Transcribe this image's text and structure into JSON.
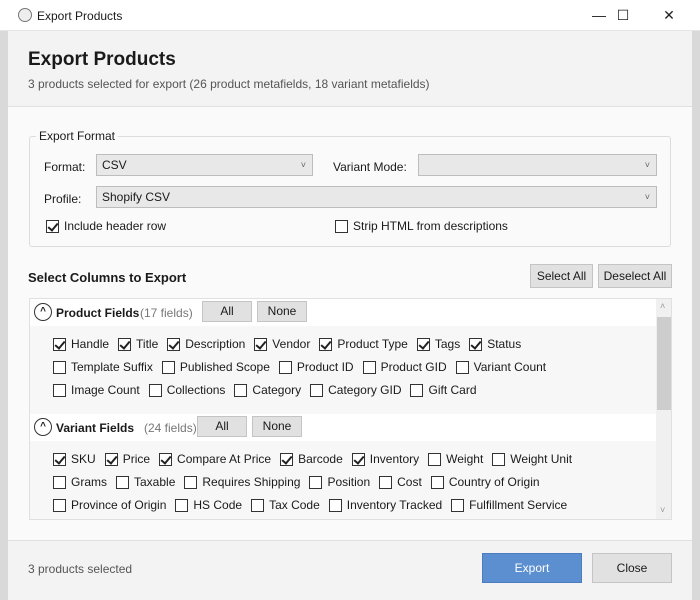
{
  "window": {
    "title": "Export Products",
    "minimize": "—",
    "maximize": "☐",
    "close": "✕"
  },
  "header": {
    "title": "Export Products",
    "subtitle": "3 products selected for export (26 product metafields, 18 variant metafields)"
  },
  "format": {
    "legend": "Export Format",
    "format_label": "Format:",
    "format_value": "CSV",
    "variant_mode_label": "Variant Mode:",
    "variant_mode_value": "",
    "profile_label": "Profile:",
    "profile_value": "Shopify CSV",
    "include_header": {
      "label": "Include header row",
      "checked": true
    },
    "strip_html": {
      "label": "Strip HTML from descriptions",
      "checked": false
    },
    "chevron": "˅"
  },
  "columns": {
    "title": "Select Columns to Export",
    "select_all": "Select All",
    "deselect_all": "Deselect All"
  },
  "sections": [
    {
      "title": "Product Fields",
      "count": "(17 fields)",
      "all": "All",
      "none": "None",
      "rows": [
        [
          [
            "Handle",
            true
          ],
          [
            "Title",
            true
          ],
          [
            "Description",
            true
          ],
          [
            "Vendor",
            true
          ],
          [
            "Product Type",
            true
          ],
          [
            "Tags",
            true
          ],
          [
            "Status",
            true
          ]
        ],
        [
          [
            "Template Suffix",
            false
          ],
          [
            "Published Scope",
            false
          ],
          [
            "Product ID",
            false
          ],
          [
            "Product GID",
            false
          ],
          [
            "Variant Count",
            false
          ]
        ],
        [
          [
            "Image Count",
            false
          ],
          [
            "Collections",
            false
          ],
          [
            "Category",
            false
          ],
          [
            "Category GID",
            false
          ],
          [
            "Gift Card",
            false
          ]
        ]
      ]
    },
    {
      "title": "Variant Fields",
      "count": "(24 fields)",
      "all": "All",
      "none": "None",
      "rows": [
        [
          [
            "SKU",
            true
          ],
          [
            "Price",
            true
          ],
          [
            "Compare At Price",
            true
          ],
          [
            "Barcode",
            true
          ],
          [
            "Inventory",
            true
          ],
          [
            "Weight",
            false
          ],
          [
            "Weight Unit",
            false
          ]
        ],
        [
          [
            "Grams",
            false
          ],
          [
            "Taxable",
            false
          ],
          [
            "Requires Shipping",
            false
          ],
          [
            "Position",
            false
          ],
          [
            "Cost",
            false
          ],
          [
            "Country of Origin",
            false
          ]
        ],
        [
          [
            "Province of Origin",
            false
          ],
          [
            "HS Code",
            false
          ],
          [
            "Tax Code",
            false
          ],
          [
            "Inventory Tracked",
            false
          ],
          [
            "Fulfillment Service",
            false
          ]
        ]
      ]
    }
  ],
  "footer": {
    "status": "3 products selected",
    "export": "Export",
    "close": "Close"
  }
}
